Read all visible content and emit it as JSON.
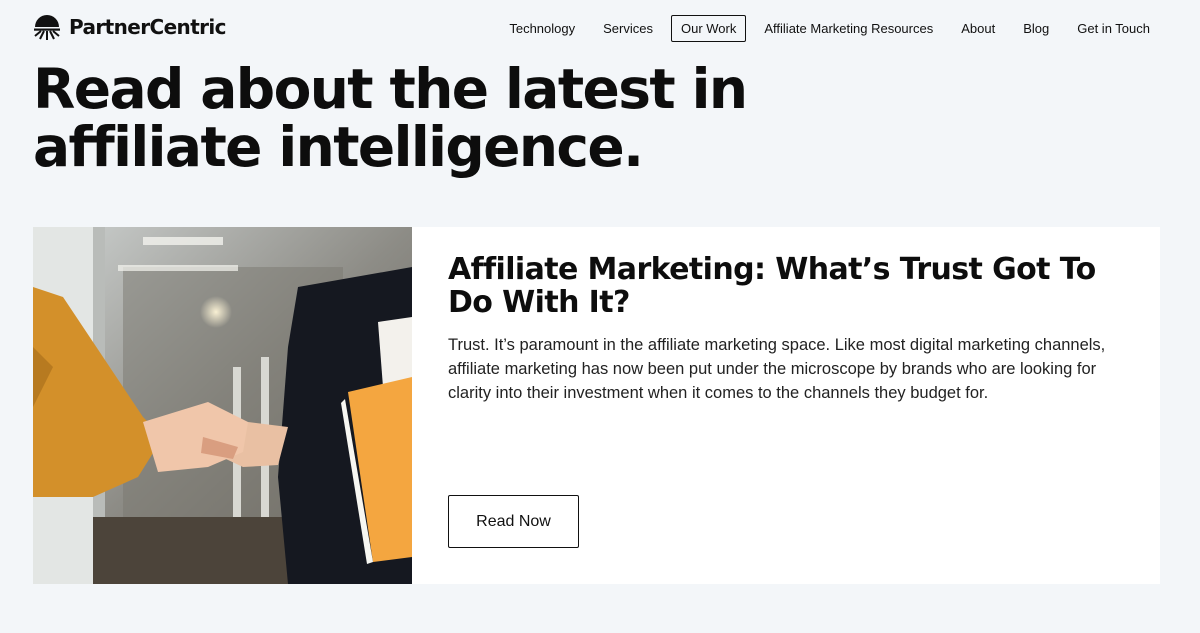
{
  "brand": {
    "name": "PartnerCentric",
    "logo_icon": "sunrise-logo-icon"
  },
  "nav": {
    "items": [
      {
        "label": "Technology",
        "active": false
      },
      {
        "label": "Services",
        "active": false
      },
      {
        "label": "Our Work",
        "active": true
      },
      {
        "label": "Affiliate Marketing Resources",
        "active": false
      },
      {
        "label": "About",
        "active": false
      },
      {
        "label": "Blog",
        "active": false
      },
      {
        "label": "Get in Touch",
        "active": false
      }
    ]
  },
  "hero": {
    "title_line1": "Read about the latest in",
    "title_line2": "affiliate intelligence."
  },
  "article": {
    "image_subject": "handshake-photo",
    "title": "Affiliate Marketing: What’s Trust Got To Do With It?",
    "excerpt": "Trust. It’s paramount in the affiliate marketing space.  Like most digital marketing channels, affiliate marketing has now been put under the microscope by brands who are looking for clarity into their investment when it comes to the channels they budget for.",
    "button_label": "Read Now"
  },
  "colors": {
    "page_bg": "#f3f6f9",
    "card_bg": "#ffffff",
    "text": "#111111",
    "accent_orange": "#f4a640"
  }
}
